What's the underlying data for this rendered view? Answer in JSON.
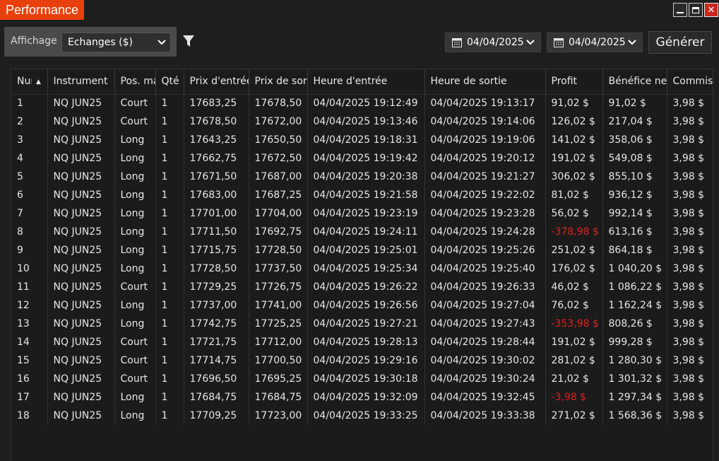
{
  "window": {
    "title": "Performance",
    "minimize_icon": "minimize-icon",
    "maximize_icon": "maximize-icon",
    "close_icon": "close-icon",
    "close_glyph": "✕"
  },
  "toolbar": {
    "display_label": "Affichage",
    "display_value": "Echanges ($)",
    "chevron": "⌄",
    "filter_icon": "filter-icon",
    "calendar_icon": "calendar-icon",
    "date_from": "04/04/2025",
    "date_to": "04/04/2025",
    "generate_label": "Générer"
  },
  "grid": {
    "sort_indicator": "▲",
    "columns": [
      "Numéro",
      "Instrument",
      "Pos. marché",
      "Qté",
      "Prix d'entrée",
      "Prix de sortie",
      "Heure d'entrée",
      "Heure de sortie",
      "Profit",
      "Bénéfice net",
      "Commission"
    ],
    "rows": [
      [
        "1",
        "NQ JUN25",
        "Court",
        "1",
        "17683,25",
        "17678,50",
        "04/04/2025 19:12:49",
        "04/04/2025 19:13:17",
        "91,02 $",
        "91,02 $",
        "3,98 $"
      ],
      [
        "2",
        "NQ JUN25",
        "Court",
        "1",
        "17678,50",
        "17672,00",
        "04/04/2025 19:13:46",
        "04/04/2025 19:14:06",
        "126,02 $",
        "217,04 $",
        "3,98 $"
      ],
      [
        "3",
        "NQ JUN25",
        "Long",
        "1",
        "17643,25",
        "17650,50",
        "04/04/2025 19:18:31",
        "04/04/2025 19:19:06",
        "141,02 $",
        "358,06 $",
        "3,98 $"
      ],
      [
        "4",
        "NQ JUN25",
        "Long",
        "1",
        "17662,75",
        "17672,50",
        "04/04/2025 19:19:42",
        "04/04/2025 19:20:12",
        "191,02 $",
        "549,08 $",
        "3,98 $"
      ],
      [
        "5",
        "NQ JUN25",
        "Long",
        "1",
        "17671,50",
        "17687,00",
        "04/04/2025 19:20:38",
        "04/04/2025 19:21:27",
        "306,02 $",
        "855,10 $",
        "3,98 $"
      ],
      [
        "6",
        "NQ JUN25",
        "Long",
        "1",
        "17683,00",
        "17687,25",
        "04/04/2025 19:21:58",
        "04/04/2025 19:22:02",
        "81,02 $",
        "936,12 $",
        "3,98 $"
      ],
      [
        "7",
        "NQ JUN25",
        "Long",
        "1",
        "17701,00",
        "17704,00",
        "04/04/2025 19:23:19",
        "04/04/2025 19:23:28",
        "56,02 $",
        "992,14 $",
        "3,98 $"
      ],
      [
        "8",
        "NQ JUN25",
        "Long",
        "1",
        "17711,50",
        "17692,75",
        "04/04/2025 19:24:11",
        "04/04/2025 19:24:28",
        "-378,98 $",
        "613,16 $",
        "3,98 $"
      ],
      [
        "9",
        "NQ JUN25",
        "Long",
        "1",
        "17715,75",
        "17728,50",
        "04/04/2025 19:25:01",
        "04/04/2025 19:25:26",
        "251,02 $",
        "864,18 $",
        "3,98 $"
      ],
      [
        "10",
        "NQ JUN25",
        "Long",
        "1",
        "17728,50",
        "17737,50",
        "04/04/2025 19:25:34",
        "04/04/2025 19:25:40",
        "176,02 $",
        "1 040,20 $",
        "3,98 $"
      ],
      [
        "11",
        "NQ JUN25",
        "Court",
        "1",
        "17729,25",
        "17726,75",
        "04/04/2025 19:26:22",
        "04/04/2025 19:26:33",
        "46,02 $",
        "1 086,22 $",
        "3,98 $"
      ],
      [
        "12",
        "NQ JUN25",
        "Long",
        "1",
        "17737,00",
        "17741,00",
        "04/04/2025 19:26:56",
        "04/04/2025 19:27:04",
        "76,02 $",
        "1 162,24 $",
        "3,98 $"
      ],
      [
        "13",
        "NQ JUN25",
        "Long",
        "1",
        "17742,75",
        "17725,25",
        "04/04/2025 19:27:21",
        "04/04/2025 19:27:43",
        "-353,98 $",
        "808,26 $",
        "3,98 $"
      ],
      [
        "14",
        "NQ JUN25",
        "Court",
        "1",
        "17721,75",
        "17712,00",
        "04/04/2025 19:28:13",
        "04/04/2025 19:28:44",
        "191,02 $",
        "999,28 $",
        "3,98 $"
      ],
      [
        "15",
        "NQ JUN25",
        "Court",
        "1",
        "17714,75",
        "17700,50",
        "04/04/2025 19:29:16",
        "04/04/2025 19:30:02",
        "281,02 $",
        "1 280,30 $",
        "3,98 $"
      ],
      [
        "16",
        "NQ JUN25",
        "Court",
        "1",
        "17696,50",
        "17695,25",
        "04/04/2025 19:30:18",
        "04/04/2025 19:30:24",
        "21,02 $",
        "1 301,32 $",
        "3,98 $"
      ],
      [
        "17",
        "NQ JUN25",
        "Long",
        "1",
        "17684,75",
        "17684,75",
        "04/04/2025 19:32:09",
        "04/04/2025 19:32:45",
        "-3,98 $",
        "1 297,34 $",
        "3,98 $"
      ],
      [
        "18",
        "NQ JUN25",
        "Long",
        "1",
        "17709,25",
        "17723,00",
        "04/04/2025 19:33:25",
        "04/04/2025 19:33:38",
        "271,02 $",
        "1 568,36 $",
        "3,98 $"
      ]
    ]
  },
  "colors": {
    "accent": "#e8400c",
    "negative": "#e0201e",
    "background": "#1e1e1e"
  }
}
